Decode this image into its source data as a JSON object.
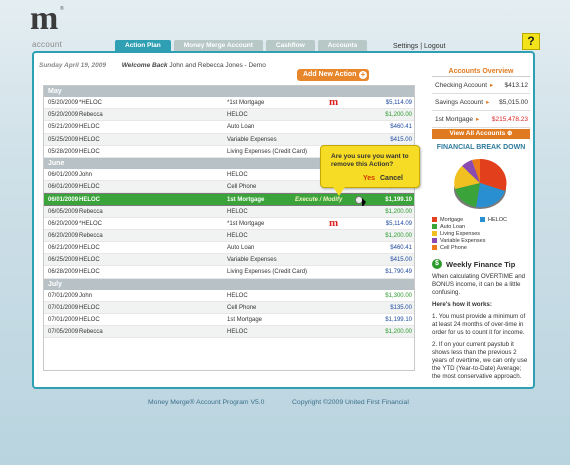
{
  "brand": {
    "logo_letter": "m",
    "logo_mark": "®",
    "logo_sub": "account"
  },
  "tabs": [
    "Action Plan",
    "Money Merge Account",
    "Cashflow",
    "Accounts"
  ],
  "top_links": {
    "settings": "Settings",
    "sep": "|",
    "logout": "Logout"
  },
  "help": "?",
  "header": {
    "date": "Sunday April 19, 2009",
    "welcome": "Welcome Back",
    "user": "John and Rebecca Jones - Demo"
  },
  "add_action": {
    "label": "Add New Action",
    "plus": "+"
  },
  "groups": [
    {
      "name": "May",
      "rows": [
        {
          "date": "05/20/2009",
          "name": "*HELOC",
          "desc": "*1st Mortgage",
          "amt": "$5,114.09",
          "color": "blue",
          "logo": true
        },
        {
          "date": "05/20/2009",
          "name": "Rebecca",
          "desc": "HELOC",
          "amt": "$1,200.00",
          "color": "green"
        },
        {
          "date": "05/21/2009",
          "name": "HELOC",
          "desc": "Auto Loan",
          "amt": "$460.41",
          "color": "blue"
        },
        {
          "date": "05/25/2009",
          "name": "HELOC",
          "desc": "Variable Expenses",
          "amt": "$415.00",
          "color": "blue"
        },
        {
          "date": "05/28/2009",
          "name": "HELOC",
          "desc": "Living Expenses (Credit Card)",
          "amt": "$1,790.49",
          "color": "blue"
        }
      ]
    },
    {
      "name": "June",
      "rows": [
        {
          "date": "06/01/2009",
          "name": "John",
          "desc": "HELOC",
          "amt": "$1,300.00",
          "color": "green"
        },
        {
          "date": "06/01/2009",
          "name": "HELOC",
          "desc": "Cell Phone",
          "amt": "$135.00",
          "color": "blue"
        },
        {
          "date": "06/01/2009",
          "name": "HELOC",
          "desc": "1st Mortgage",
          "amt": "$1,199.10",
          "color": "blue",
          "selected": true,
          "exec": "Execute / Modify"
        },
        {
          "date": "06/05/2009",
          "name": "Rebecca",
          "desc": "HELOC",
          "amt": "$1,200.00",
          "color": "green"
        },
        {
          "date": "06/20/2009",
          "name": "*HELOC",
          "desc": "*1st Mortgage",
          "amt": "$5,114.09",
          "color": "blue",
          "logo": true
        },
        {
          "date": "06/20/2009",
          "name": "Rebecca",
          "desc": "HELOC",
          "amt": "$1,200.00",
          "color": "green"
        },
        {
          "date": "06/21/2009",
          "name": "HELOC",
          "desc": "Auto Loan",
          "amt": "$460.41",
          "color": "blue"
        },
        {
          "date": "06/25/2009",
          "name": "HELOC",
          "desc": "Variable Expenses",
          "amt": "$415.00",
          "color": "blue"
        },
        {
          "date": "06/28/2009",
          "name": "HELOC",
          "desc": "Living Expenses (Credit Card)",
          "amt": "$1,790.49",
          "color": "blue"
        }
      ]
    },
    {
      "name": "July",
      "rows": [
        {
          "date": "07/01/2009",
          "name": "John",
          "desc": "HELOC",
          "amt": "$1,300.00",
          "color": "green"
        },
        {
          "date": "07/01/2009",
          "name": "HELOC",
          "desc": "Cell Phone",
          "amt": "$135.00",
          "color": "blue"
        },
        {
          "date": "07/01/2009",
          "name": "HELOC",
          "desc": "1st Mortgage",
          "amt": "$1,199.10",
          "color": "blue"
        },
        {
          "date": "07/05/2009",
          "name": "Rebecca",
          "desc": "HELOC",
          "amt": "$1,200.00",
          "color": "green"
        }
      ]
    }
  ],
  "confirm": {
    "question": "Are you sure you want to remove this Action?",
    "yes": "Yes",
    "cancel": "Cancel"
  },
  "overview": {
    "title": "Accounts Overview",
    "rows": [
      {
        "label": "Checking Account",
        "value": "$413.12"
      },
      {
        "label": "Savings Account",
        "value": "$5,015.00"
      },
      {
        "label": "1st Mortgage",
        "value": "$215,478.23",
        "red": true
      }
    ],
    "view_all": "View All Accounts"
  },
  "breakdown": {
    "title": "FINANCIAL BREAK DOWN",
    "legend": [
      {
        "label": "Mortgage",
        "color": "#e2401c"
      },
      {
        "label": "HELOC",
        "color": "#2a8fd0"
      },
      {
        "label": "Auto Loan",
        "color": "#3aa33a"
      },
      {
        "label": "Living Expenses",
        "color": "#f0c020"
      },
      {
        "label": "Variable Expenses",
        "color": "#8a4ab0"
      },
      {
        "label": "Cell Phone",
        "color": "#ef7a1a"
      }
    ]
  },
  "tip": {
    "icon": "$",
    "title": "Weekly Finance Tip",
    "intro": "When calculating OVERTIME and BONUS income, it can be a little confusing.",
    "heading": "Here's how it works:",
    "p1": "1. You must provide a minimum of at least 24 months of over-time in order for us to count it for income.",
    "p2": "2. If on your current paystub it shows less than the previous 2 years of overtime, we can only use the YTD (Year-to-Date) Average; the most conservative approach."
  },
  "footer": {
    "program": "Money Merge® Account Program V5.0",
    "copyright": "Copyright ©2009 United First Financial"
  }
}
